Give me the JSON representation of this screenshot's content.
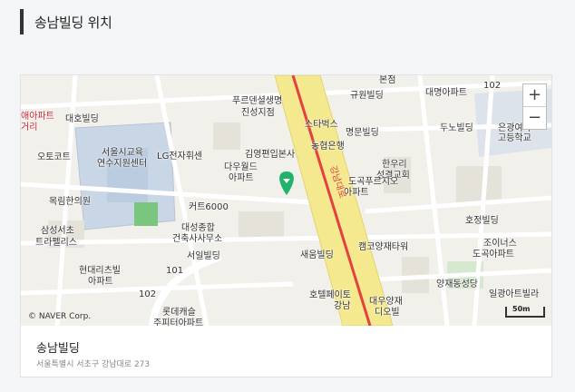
{
  "section": {
    "title": "송남빌딩 위치"
  },
  "map": {
    "zoom_in": "+",
    "zoom_out": "−",
    "credit": "© NAVER Corp.",
    "scale": "50m",
    "road_name": "강남대로",
    "labels": [
      "대호빌딩",
      "서울시교육",
      "연수지원센터",
      "오토코트",
      "LG전자휘센",
      "목림한의원",
      "삼성서초",
      "트라펠리스",
      "현대리츠빌",
      "아파트",
      "롯데캐슬",
      "주피터아파트",
      "푸르덴셜생명",
      "진성지점",
      "스타벅스",
      "농협은행",
      "규원빌딩",
      "명문빌딩",
      "대명아파트",
      "두노빌딩",
      "은광여자",
      "고등학교",
      "김영편입본사",
      "다우월드",
      "아파트",
      "한우리",
      "성결교회",
      "도곡푸르지오",
      "아파트",
      "커트6000",
      "대성종합",
      "건축사사무소",
      "서일빌딩",
      "새움빌딩",
      "캠코양재타워",
      "호텔페이토",
      "강남",
      "대우양재",
      "디오빌",
      "호정빌딩",
      "조이너스",
      "도곡아파트",
      "양재동성당",
      "일광아트빌라",
      "본점",
      "102",
      "101",
      "102",
      "애아파트",
      "거리"
    ]
  },
  "place": {
    "name": "송남빌딩",
    "address": "서울특별시 서초구 강남대로 273"
  },
  "colors": {
    "road": "#f5e98f",
    "road_line": "#e54040",
    "marker": "#21b36b",
    "park": "#7ac67f",
    "school": "#c9d6e6"
  }
}
